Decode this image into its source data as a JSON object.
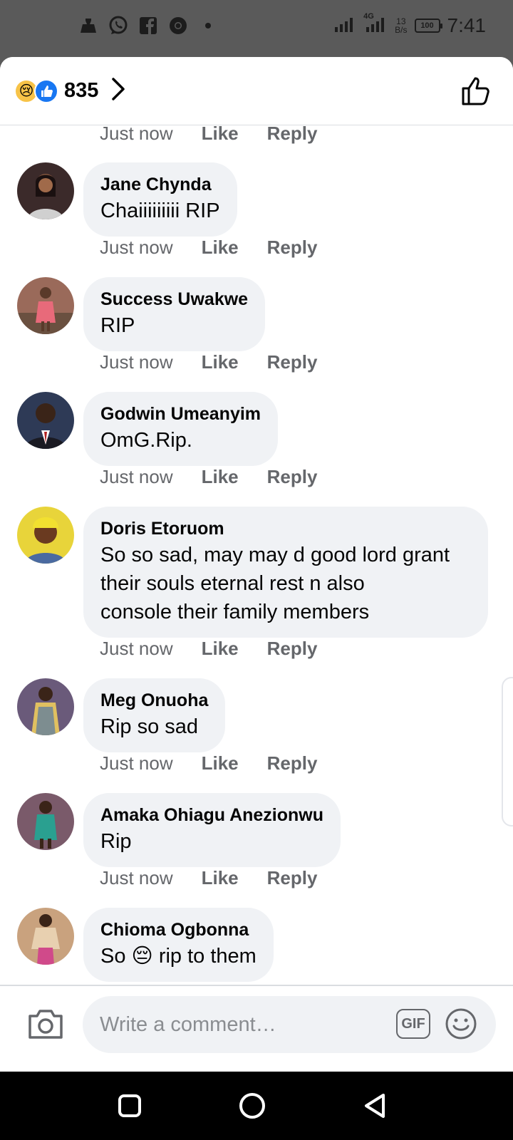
{
  "status_bar": {
    "time": "7:41",
    "net_speed_value": "13",
    "net_speed_unit": "B/s",
    "network": "4G",
    "battery": "100",
    "icons": [
      "user-icon",
      "whatsapp-icon",
      "facebook-icon",
      "chrome-icon",
      "dot-icon"
    ]
  },
  "header": {
    "reaction_count": "835",
    "reaction_icons": [
      "sad-emoji-icon",
      "like-reaction-icon"
    ]
  },
  "top_partial_meta": {
    "time": "Just now",
    "like": "Like",
    "reply": "Reply"
  },
  "comments": [
    {
      "name": "Jane Chynda",
      "text": "Chaiiiiiiiii RIP",
      "time": "Just now",
      "like": "Like",
      "reply": "Reply",
      "avatar_color": "#3b2a2a"
    },
    {
      "name": "Success Uwakwe",
      "text": "RIP",
      "time": "Just now",
      "like": "Like",
      "reply": "Reply",
      "avatar_color": "#c2585e"
    },
    {
      "name": "Godwin Umeanyim",
      "text": "OmG.Rip.",
      "time": "Just now",
      "like": "Like",
      "reply": "Reply",
      "avatar_color": "#2e3a56"
    },
    {
      "name": "Doris Etoruom",
      "text": "So so sad, may may d good lord grant\ntheir souls eternal rest n also\nconsole their family members",
      "time": "Just now",
      "like": "Like",
      "reply": "Reply",
      "avatar_color": "#e8d43a"
    },
    {
      "name": "Meg Onuoha",
      "text": "Rip so sad",
      "time": "Just now",
      "like": "Like",
      "reply": "Reply",
      "avatar_color": "#6a5a7a"
    },
    {
      "name": "Amaka Ohiagu Anezionwu",
      "text": "Rip",
      "time": "Just now",
      "like": "Like",
      "reply": "Reply",
      "avatar_color": "#4a8a7a"
    },
    {
      "name": "Chioma Ogbonna",
      "text": "So 😔 rip to them",
      "avatar_color": "#c9a27e"
    }
  ],
  "composer": {
    "placeholder": "Write a comment…",
    "gif_label": "GIF"
  },
  "colors": {
    "bubble_bg": "#f0f2f5",
    "meta_text": "#65676b",
    "like_blue": "#1877f2"
  }
}
